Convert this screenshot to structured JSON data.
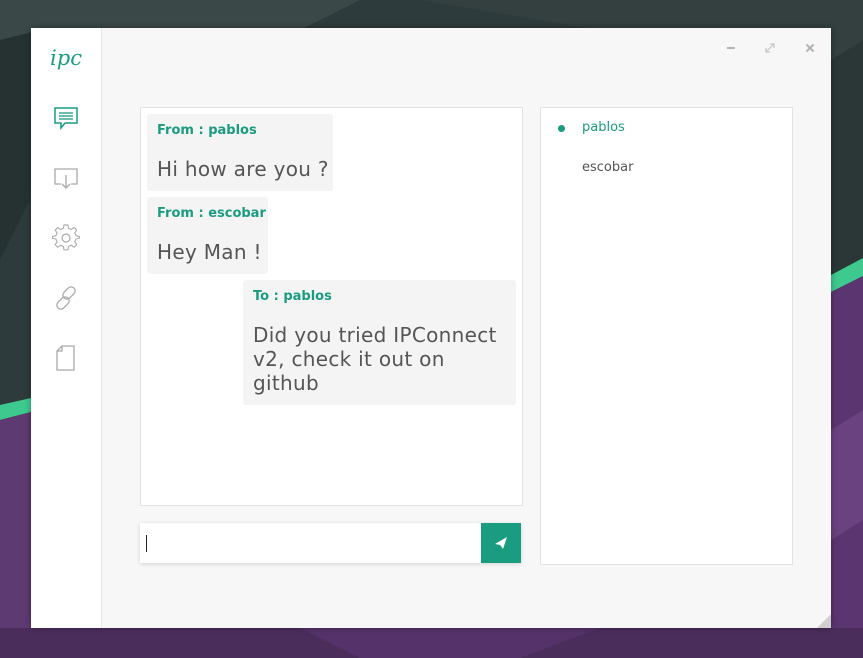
{
  "app": {
    "logo_text": "ipc",
    "accent_color": "#1a9c80"
  },
  "window_controls": {
    "icons": [
      "minimize-icon",
      "maximize-icon",
      "close-icon"
    ]
  },
  "sidebar": {
    "items": [
      {
        "icon": "chat-icon",
        "label": "Chat"
      },
      {
        "icon": "download-icon",
        "label": "Download"
      },
      {
        "icon": "gear-icon",
        "label": "Settings"
      },
      {
        "icon": "link-icon",
        "label": "Connect"
      },
      {
        "icon": "file-icon",
        "label": "File"
      }
    ]
  },
  "chat": {
    "messages": [
      {
        "direction": "from",
        "header": "From : pablos",
        "lines": [
          "Hi how are you ?"
        ]
      },
      {
        "direction": "from",
        "header": "From : escobar",
        "lines": [
          "Hey Man !"
        ]
      },
      {
        "direction": "to",
        "header": "To : pablos",
        "lines": [
          "Did you tried IPConnect",
          "v2, check it out on",
          "github"
        ]
      }
    ]
  },
  "composer": {
    "value": "",
    "placeholder": "",
    "send_icon": "send-icon"
  },
  "users": {
    "items": [
      {
        "name": "pablos",
        "online": true,
        "active": true
      },
      {
        "name": "escobar",
        "online": false,
        "active": false
      }
    ]
  }
}
